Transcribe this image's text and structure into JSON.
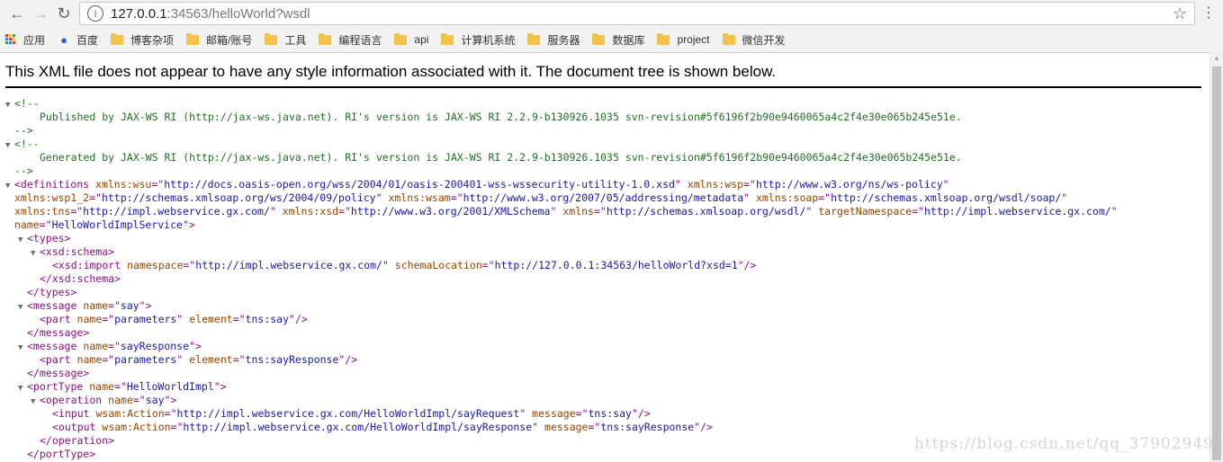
{
  "browser": {
    "url_host": "127.0.0.1",
    "url_rest": ":34563/helloWorld?wsdl",
    "info_icon": "i"
  },
  "bookmarks": [
    {
      "label": "应用",
      "icon": "apps-icon"
    },
    {
      "label": "百度",
      "icon": "paw-icon"
    },
    {
      "label": "博客杂项",
      "icon": "folder-icon"
    },
    {
      "label": "邮箱/账号",
      "icon": "folder-icon"
    },
    {
      "label": "工具",
      "icon": "folder-icon"
    },
    {
      "label": "编程语言",
      "icon": "folder-icon"
    },
    {
      "label": "api",
      "icon": "folder-icon"
    },
    {
      "label": "计算机系统",
      "icon": "folder-icon"
    },
    {
      "label": "服务器",
      "icon": "folder-icon"
    },
    {
      "label": "数据库",
      "icon": "folder-icon"
    },
    {
      "label": "project",
      "icon": "folder-icon"
    },
    {
      "label": "微信开发",
      "icon": "folder-icon"
    }
  ],
  "page": {
    "banner": "This XML file does not appear to have any style information associated with it. The document tree is shown below.",
    "xml_lines": [
      {
        "t": 1,
        "i": 0,
        "parts": [
          [
            "cm",
            "<!--"
          ]
        ]
      },
      {
        "t": 0,
        "i": 2,
        "parts": [
          [
            "cm",
            "Published by JAX-WS RI (http://jax-ws.java.net). RI's version is JAX-WS RI 2.2.9-b130926.1035 svn-revision#5f6196f2b90e9460065a4c2f4e30e065b245e51e."
          ]
        ]
      },
      {
        "t": 0,
        "i": 0,
        "parts": [
          [
            "cm",
            "-->"
          ]
        ]
      },
      {
        "t": 1,
        "i": 0,
        "parts": [
          [
            "cm",
            "<!--"
          ]
        ]
      },
      {
        "t": 0,
        "i": 2,
        "parts": [
          [
            "cm",
            "Generated by JAX-WS RI (http://jax-ws.java.net). RI's version is JAX-WS RI 2.2.9-b130926.1035 svn-revision#5f6196f2b90e9460065a4c2f4e30e065b245e51e."
          ]
        ]
      },
      {
        "t": 0,
        "i": 0,
        "parts": [
          [
            "cm",
            "-->"
          ]
        ]
      },
      {
        "t": 1,
        "i": 0,
        "parts": [
          [
            "tg",
            "<definitions "
          ],
          [
            "an",
            "xmlns:wsu"
          ],
          [
            "tg",
            "=\""
          ],
          [
            "av",
            "http://docs.oasis-open.org/wss/2004/01/oasis-200401-wss-wssecurity-utility-1.0.xsd"
          ],
          [
            "tg",
            "\" "
          ],
          [
            "an",
            "xmlns:wsp"
          ],
          [
            "tg",
            "=\""
          ],
          [
            "av",
            "http://www.w3.org/ns/ws-policy"
          ],
          [
            "tg",
            "\""
          ]
        ]
      },
      {
        "t": 0,
        "i": 0,
        "parts": [
          [
            "an",
            "xmlns:wsp1_2"
          ],
          [
            "tg",
            "=\""
          ],
          [
            "av",
            "http://schemas.xmlsoap.org/ws/2004/09/policy"
          ],
          [
            "tg",
            "\" "
          ],
          [
            "an",
            "xmlns:wsam"
          ],
          [
            "tg",
            "=\""
          ],
          [
            "av",
            "http://www.w3.org/2007/05/addressing/metadata"
          ],
          [
            "tg",
            "\" "
          ],
          [
            "an",
            "xmlns:soap"
          ],
          [
            "tg",
            "=\""
          ],
          [
            "av",
            "http://schemas.xmlsoap.org/wsdl/soap/"
          ],
          [
            "tg",
            "\""
          ]
        ]
      },
      {
        "t": 0,
        "i": 0,
        "parts": [
          [
            "an",
            "xmlns:tns"
          ],
          [
            "tg",
            "=\""
          ],
          [
            "av",
            "http://impl.webservice.gx.com/"
          ],
          [
            "tg",
            "\" "
          ],
          [
            "an",
            "xmlns:xsd"
          ],
          [
            "tg",
            "=\""
          ],
          [
            "av",
            "http://www.w3.org/2001/XMLSchema"
          ],
          [
            "tg",
            "\" "
          ],
          [
            "an",
            "xmlns"
          ],
          [
            "tg",
            "=\""
          ],
          [
            "av",
            "http://schemas.xmlsoap.org/wsdl/"
          ],
          [
            "tg",
            "\" "
          ],
          [
            "an",
            "targetNamespace"
          ],
          [
            "tg",
            "=\""
          ],
          [
            "av",
            "http://impl.webservice.gx.com/"
          ],
          [
            "tg",
            "\""
          ]
        ]
      },
      {
        "t": 0,
        "i": 0,
        "parts": [
          [
            "an",
            "name"
          ],
          [
            "tg",
            "=\""
          ],
          [
            "av",
            "HelloWorldImplService"
          ],
          [
            "tg",
            "\">"
          ]
        ]
      },
      {
        "t": 1,
        "i": 1,
        "parts": [
          [
            "tg",
            "<types>"
          ]
        ]
      },
      {
        "t": 1,
        "i": 2,
        "parts": [
          [
            "tg",
            "<xsd:schema>"
          ]
        ]
      },
      {
        "t": 0,
        "i": 3,
        "parts": [
          [
            "tg",
            "<xsd:import "
          ],
          [
            "an",
            "namespace"
          ],
          [
            "tg",
            "=\""
          ],
          [
            "av",
            "http://impl.webservice.gx.com/"
          ],
          [
            "tg",
            "\" "
          ],
          [
            "an",
            "schemaLocation"
          ],
          [
            "tg",
            "=\""
          ],
          [
            "av",
            "http://127.0.0.1:34563/helloWorld?xsd=1"
          ],
          [
            "tg",
            "\"/>"
          ]
        ]
      },
      {
        "t": 0,
        "i": 2,
        "parts": [
          [
            "tg",
            "</xsd:schema>"
          ]
        ]
      },
      {
        "t": 0,
        "i": 1,
        "parts": [
          [
            "tg",
            "</types>"
          ]
        ]
      },
      {
        "t": 1,
        "i": 1,
        "parts": [
          [
            "tg",
            "<message "
          ],
          [
            "an",
            "name"
          ],
          [
            "tg",
            "=\""
          ],
          [
            "av",
            "say"
          ],
          [
            "tg",
            "\">"
          ]
        ]
      },
      {
        "t": 0,
        "i": 2,
        "parts": [
          [
            "tg",
            "<part "
          ],
          [
            "an",
            "name"
          ],
          [
            "tg",
            "=\""
          ],
          [
            "av",
            "parameters"
          ],
          [
            "tg",
            "\" "
          ],
          [
            "an",
            "element"
          ],
          [
            "tg",
            "=\""
          ],
          [
            "av",
            "tns:say"
          ],
          [
            "tg",
            "\"/>"
          ]
        ]
      },
      {
        "t": 0,
        "i": 1,
        "parts": [
          [
            "tg",
            "</message>"
          ]
        ]
      },
      {
        "t": 1,
        "i": 1,
        "parts": [
          [
            "tg",
            "<message "
          ],
          [
            "an",
            "name"
          ],
          [
            "tg",
            "=\""
          ],
          [
            "av",
            "sayResponse"
          ],
          [
            "tg",
            "\">"
          ]
        ]
      },
      {
        "t": 0,
        "i": 2,
        "parts": [
          [
            "tg",
            "<part "
          ],
          [
            "an",
            "name"
          ],
          [
            "tg",
            "=\""
          ],
          [
            "av",
            "parameters"
          ],
          [
            "tg",
            "\" "
          ],
          [
            "an",
            "element"
          ],
          [
            "tg",
            "=\""
          ],
          [
            "av",
            "tns:sayResponse"
          ],
          [
            "tg",
            "\"/>"
          ]
        ]
      },
      {
        "t": 0,
        "i": 1,
        "parts": [
          [
            "tg",
            "</message>"
          ]
        ]
      },
      {
        "t": 1,
        "i": 1,
        "parts": [
          [
            "tg",
            "<portType "
          ],
          [
            "an",
            "name"
          ],
          [
            "tg",
            "=\""
          ],
          [
            "av",
            "HelloWorldImpl"
          ],
          [
            "tg",
            "\">"
          ]
        ]
      },
      {
        "t": 1,
        "i": 2,
        "parts": [
          [
            "tg",
            "<operation "
          ],
          [
            "an",
            "name"
          ],
          [
            "tg",
            "=\""
          ],
          [
            "av",
            "say"
          ],
          [
            "tg",
            "\">"
          ]
        ]
      },
      {
        "t": 0,
        "i": 3,
        "parts": [
          [
            "tg",
            "<input "
          ],
          [
            "an",
            "wsam:Action"
          ],
          [
            "tg",
            "=\""
          ],
          [
            "av",
            "http://impl.webservice.gx.com/HelloWorldImpl/sayRequest"
          ],
          [
            "tg",
            "\" "
          ],
          [
            "an",
            "message"
          ],
          [
            "tg",
            "=\""
          ],
          [
            "av",
            "tns:say"
          ],
          [
            "tg",
            "\"/>"
          ]
        ]
      },
      {
        "t": 0,
        "i": 3,
        "parts": [
          [
            "tg",
            "<output "
          ],
          [
            "an",
            "wsam:Action"
          ],
          [
            "tg",
            "=\""
          ],
          [
            "av",
            "http://impl.webservice.gx.com/HelloWorldImpl/sayResponse"
          ],
          [
            "tg",
            "\" "
          ],
          [
            "an",
            "message"
          ],
          [
            "tg",
            "=\""
          ],
          [
            "av",
            "tns:sayResponse"
          ],
          [
            "tg",
            "\"/>"
          ]
        ]
      },
      {
        "t": 0,
        "i": 2,
        "parts": [
          [
            "tg",
            "</operation>"
          ]
        ]
      },
      {
        "t": 0,
        "i": 1,
        "parts": [
          [
            "tg",
            "</portType>"
          ]
        ]
      }
    ]
  },
  "watermark": "https://blog.csdn.net/qq_37902949",
  "colors": {
    "tag": "#881280",
    "attr_name": "#994500",
    "attr_value": "#1a1aa6",
    "comment": "#236e25"
  }
}
